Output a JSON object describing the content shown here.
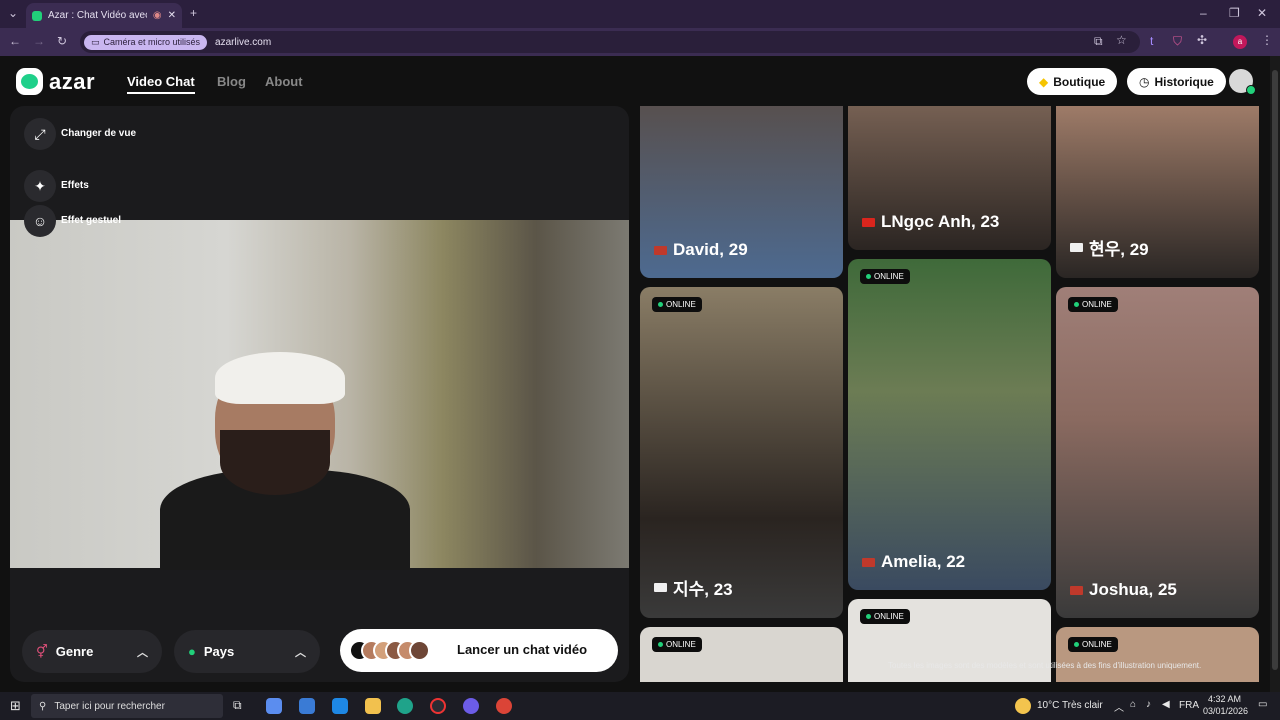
{
  "browser": {
    "tab_title": "Azar : Chat Vidéo avec de n",
    "permission_chip": "Caméra et micro utilisés",
    "url": "azarlive.com",
    "profile_initial": "a"
  },
  "header": {
    "logo": "azar",
    "nav": [
      "Video Chat",
      "Blog",
      "About"
    ],
    "shop_label": "Boutique",
    "history_label": "Historique"
  },
  "left_panel": {
    "options": [
      {
        "label": "Changer de vue",
        "icon": "expand-icon"
      },
      {
        "label": "Effets",
        "icon": "sparkle-icon"
      },
      {
        "label": "Effet gestuel",
        "icon": "face-icon"
      }
    ],
    "genre_label": "Genre",
    "pays_label": "Pays",
    "launch_label": "Lancer un chat vidéo"
  },
  "gallery": {
    "online_label": "ONLINE",
    "cards": [
      {
        "name": "David, 29",
        "flag": "us",
        "online": false
      },
      {
        "name": "LNgọc Anh, 23",
        "flag": "vn",
        "online": false
      },
      {
        "name": "현우, 29",
        "flag": "kr",
        "online": false
      },
      {
        "name": "지수, 23",
        "flag": "kr",
        "online": true
      },
      {
        "name": "Amelia, 22",
        "flag": "us",
        "online": true
      },
      {
        "name": "Joshua, 25",
        "flag": "us",
        "online": true
      },
      {
        "name": "",
        "flag": "",
        "online": true
      },
      {
        "name": "",
        "flag": "",
        "online": true
      },
      {
        "name": "",
        "flag": "",
        "online": true
      }
    ],
    "disclaimer": "Toutes les images sont des modèles et sont utilisées à des fins d'illustration uniquement."
  },
  "taskbar": {
    "search_placeholder": "Taper ici pour rechercher",
    "weather": "10°C  Très clair",
    "lang": "FRA",
    "time": "4:32 AM",
    "date": "03/01/2026"
  },
  "colors": {
    "accent": "#21d07a",
    "brand_bg": "#111111",
    "browser_chrome": "#3b2c52"
  }
}
